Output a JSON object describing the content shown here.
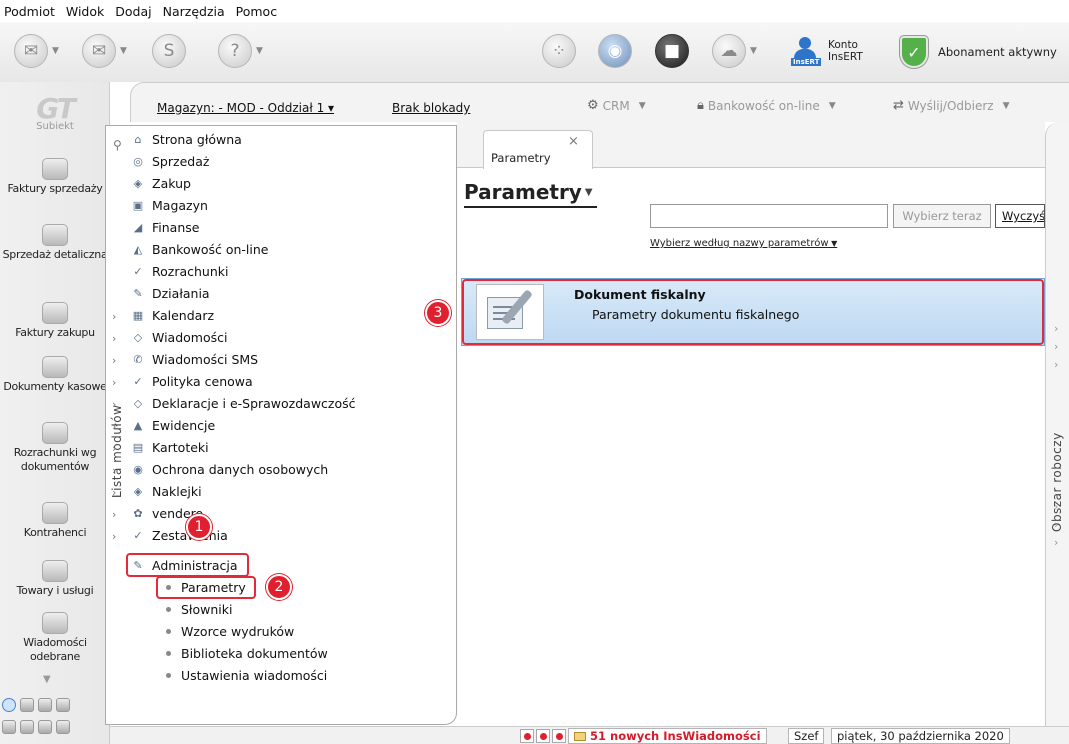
{
  "menu": [
    "Podmiot",
    "Widok",
    "Dodaj",
    "Narzędzia",
    "Pomoc"
  ],
  "toolbar": {
    "konto": {
      "line1": "Konto",
      "line2": "InsERT",
      "badge": "InsERT"
    },
    "abonament": "Abonament aktywny"
  },
  "logo": {
    "mark": "GT",
    "name": "Subiekt"
  },
  "nav": [
    {
      "label": "Faktury sprzedaży"
    },
    {
      "label": "Sprzedaż detaliczna"
    },
    {
      "label": "Faktury zakupu"
    },
    {
      "label": "Dokumenty kasowe"
    },
    {
      "label": "Rozrachunki wg dokumentów"
    },
    {
      "label": "Kontrahenci"
    },
    {
      "label": "Towary i usługi"
    },
    {
      "label": "Wiadomości odebrane"
    }
  ],
  "header": {
    "magazyn": "Magazyn: - MOD - Oddział 1 ▾",
    "blokada": "Brak blokady",
    "crm": "CRM",
    "bankowosc": "Bankowość on-line",
    "wyslij": "Wyślij/Odbierz"
  },
  "modlist": {
    "vertical_label": "Lista modułów",
    "modules": [
      "Strona główna",
      "Sprzedaż",
      "Zakup",
      "Magazyn",
      "Finanse",
      "Bankowość on-line",
      "Rozrachunki",
      "Działania",
      "Kalendarz",
      "Wiadomości",
      "Wiadomości SMS",
      "Polityka cenowa",
      "Deklaracje i e-Sprawozdawczość",
      "Ewidencje",
      "Kartoteki",
      "Ochrona danych osobowych",
      "Naklejki",
      "vendero",
      "Zestawienia",
      "Administracja"
    ],
    "submodules": [
      "Parametry",
      "Słowniki",
      "Wzorce wydruków",
      "Biblioteka dokumentów",
      "Ustawienia wiadomości"
    ]
  },
  "badges": [
    "1",
    "2",
    "3"
  ],
  "content": {
    "tab_label": "Parametry",
    "tab_close": "×",
    "title": "Parametry",
    "search_value": "",
    "choose_button": "Wybierz teraz",
    "clear_button": "Wyczyść",
    "choose_by": "Wybierz według nazwy parametrów",
    "row": {
      "title": "Dokument fiskalny",
      "subtitle": "Parametry dokumentu fiskalnego"
    }
  },
  "workspace": {
    "label": "Obszar roboczy"
  },
  "status": {
    "messages": "51 nowych InsWiadomości",
    "user": "Szef",
    "date": "piątek, 30 października 2020"
  },
  "colors": {
    "highlight": "#e32a3a",
    "selection": "#bdd8f2",
    "status_alert": "#d41c2a"
  }
}
